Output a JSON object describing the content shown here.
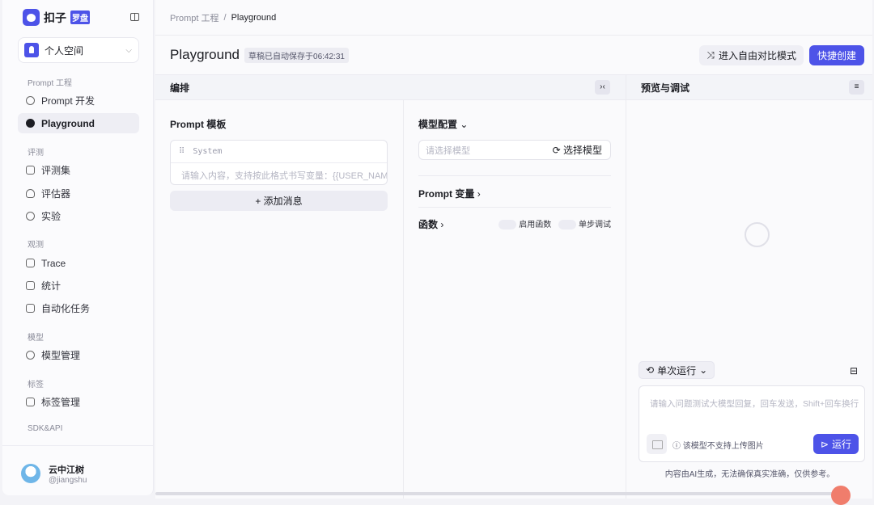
{
  "brand": {
    "name": "扣子",
    "badge": "罗盘"
  },
  "workspace": "个人空间",
  "sidebar": {
    "sections": [
      {
        "title": "Prompt 工程",
        "items": [
          "Prompt 开发",
          "Playground"
        ]
      },
      {
        "title": "评测",
        "items": [
          "评测集",
          "评估器",
          "实验"
        ]
      },
      {
        "title": "观测",
        "items": [
          "Trace",
          "统计",
          "自动化任务"
        ]
      },
      {
        "title": "模型",
        "items": [
          "模型管理"
        ]
      },
      {
        "title": "标签",
        "items": [
          "标签管理"
        ]
      },
      {
        "title": "SDK&API",
        "items": []
      }
    ],
    "active": "Playground"
  },
  "user": {
    "name": "云中江树",
    "handle": "@jiangshu"
  },
  "breadcrumb": {
    "parent": "Prompt 工程",
    "sep": "/",
    "current": "Playground"
  },
  "header": {
    "title": "Playground",
    "draft": "草稿已自动保存于06:42:31",
    "compare": "进入自由对比模式",
    "create": "快捷创建"
  },
  "editor": {
    "title": "编排",
    "template_title": "Prompt 模板",
    "role": "System",
    "placeholder": "请输入内容，支持按此格式书写变量：{{USER_NAM",
    "add_message": "+ 添加消息"
  },
  "config": {
    "model_title": "模型配置",
    "model_placeholder": "请选择模型",
    "select_model": "选择模型",
    "variables": "Prompt 变量",
    "functions": "函数",
    "enable_functions": "启用函数",
    "step_debug": "单步调试"
  },
  "preview": {
    "title": "预览与调试",
    "run_mode": "单次运行",
    "placeholder": "请输入问题测试大模型回复，回车发送，Shift+回车换行",
    "image_note": "该模型不支持上传图片",
    "run": "运行",
    "disclaimer": "内容由AI生成，无法确保真实准确，仅供参考。"
  },
  "colors": {
    "accent": "#4d53e8"
  }
}
